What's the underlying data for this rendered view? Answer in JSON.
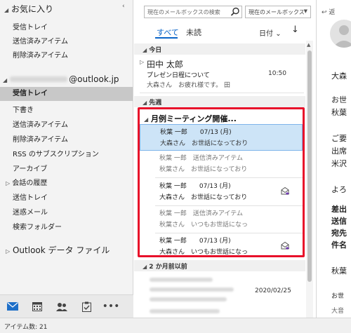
{
  "folder_pane": {
    "favorites_label": "お気に入り",
    "favorites": [
      "受信トレイ",
      "送信済みアイテム",
      "削除済みアイテム"
    ],
    "account_suffix": "@outlook.jp",
    "folders": [
      "受信トレイ",
      "下書き",
      "送信済みアイテム",
      "削除済みアイテム",
      "RSS のサブスクリプション",
      "アーカイブ",
      "会話の履歴",
      "送信トレイ",
      "迷惑メール",
      "検索フォルダー"
    ],
    "selected_folder_index": 0,
    "data_file_label": "Outlook データ ファイル"
  },
  "status_bar": {
    "item_count": "アイテム数: 21"
  },
  "list_pane": {
    "search_placeholder": "現在のメールボックスの検索",
    "scope": "現在のメールボックス",
    "tab_all": "すべて",
    "tab_unread": "未読",
    "sort_label": "日付",
    "sort_direction": "↓",
    "groups": {
      "today": "今日",
      "last_week": "先週",
      "two_months": "2 か月前以前"
    },
    "today_msg": {
      "sender": "田中 太郎",
      "subject": "プレゼン日程について",
      "time": "10:50",
      "preview": "大森さん　お疲れ様です。 田"
    },
    "thread_title": "月例ミーティング開催...",
    "thread": [
      {
        "line1": "秋葉 一郎　　07/13 (月)",
        "line2": "大森さん　お世話になっており",
        "grey": false,
        "selected": true,
        "reply_icon": false
      },
      {
        "line1": "秋葉 一郎　送信済みアイテム",
        "line2": "秋葉さん　お世話になっており",
        "grey": true,
        "selected": false,
        "reply_icon": false
      },
      {
        "line1": "秋葉 一郎　　07/13 (月)",
        "line2": "大森さん　お世話になっており",
        "grey": false,
        "selected": false,
        "reply_icon": true
      },
      {
        "line1": "秋葉 一郎　送信済みアイテム",
        "line2": "秋葉さん　いつもお世話になっ",
        "grey": true,
        "selected": false,
        "reply_icon": false
      },
      {
        "line1": "秋葉 一郎　　07/13 (月)",
        "line2": "大森さん　いつもお世話になっ",
        "grey": false,
        "selected": false,
        "reply_icon": true
      }
    ],
    "old_msg_date": "2020/02/25"
  },
  "reading_pane": {
    "reply_label": "返",
    "lines": [
      "大森",
      "お世",
      "秋葉",
      "ご要",
      "出席",
      "米沢",
      "よろ"
    ],
    "bold_lines": [
      "差出",
      "送信",
      "宛先",
      "件名"
    ],
    "signature": "秋葉",
    "footer": [
      "お世",
      "大音"
    ]
  },
  "colors": {
    "accent": "#0a64c8",
    "highlight_frame": "#e8102a",
    "selection": "#cde4f7"
  }
}
